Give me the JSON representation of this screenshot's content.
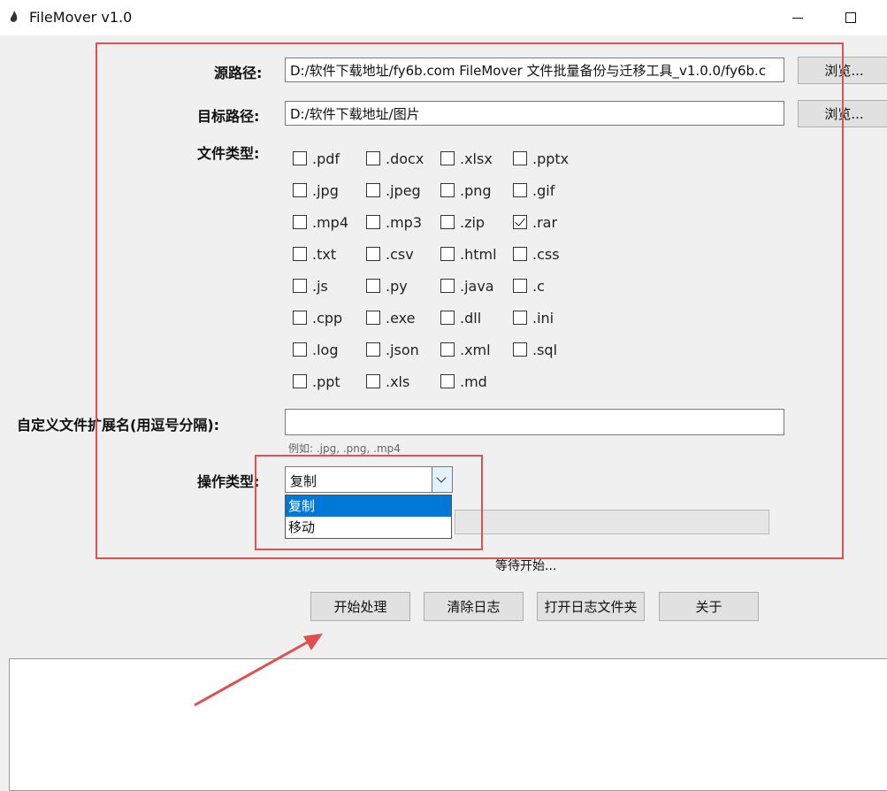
{
  "window": {
    "title": "FileMover v1.0"
  },
  "source": {
    "label": "源路径:",
    "value": "D:/软件下载地址/fy6b.com FileMover 文件批量备份与迁移工具_v1.0.0/fy6b.c",
    "browse": "浏览..."
  },
  "target": {
    "label": "目标路径:",
    "value": "D:/软件下载地址/图片",
    "browse": "浏览..."
  },
  "filetypes": {
    "label": "文件类型:",
    "items": [
      {
        "ext": ".pdf",
        "checked": false
      },
      {
        "ext": ".docx",
        "checked": false
      },
      {
        "ext": ".xlsx",
        "checked": false
      },
      {
        "ext": ".pptx",
        "checked": false
      },
      {
        "ext": ".jpg",
        "checked": false
      },
      {
        "ext": ".jpeg",
        "checked": false
      },
      {
        "ext": ".png",
        "checked": false
      },
      {
        "ext": ".gif",
        "checked": false
      },
      {
        "ext": ".mp4",
        "checked": false
      },
      {
        "ext": ".mp3",
        "checked": false
      },
      {
        "ext": ".zip",
        "checked": false
      },
      {
        "ext": ".rar",
        "checked": true
      },
      {
        "ext": ".txt",
        "checked": false
      },
      {
        "ext": ".csv",
        "checked": false
      },
      {
        "ext": ".html",
        "checked": false
      },
      {
        "ext": ".css",
        "checked": false
      },
      {
        "ext": ".js",
        "checked": false
      },
      {
        "ext": ".py",
        "checked": false
      },
      {
        "ext": ".java",
        "checked": false
      },
      {
        "ext": ".c",
        "checked": false
      },
      {
        "ext": ".cpp",
        "checked": false
      },
      {
        "ext": ".exe",
        "checked": false
      },
      {
        "ext": ".dll",
        "checked": false
      },
      {
        "ext": ".ini",
        "checked": false
      },
      {
        "ext": ".log",
        "checked": false
      },
      {
        "ext": ".json",
        "checked": false
      },
      {
        "ext": ".xml",
        "checked": false
      },
      {
        "ext": ".sql",
        "checked": false
      },
      {
        "ext": ".ppt",
        "checked": false
      },
      {
        "ext": ".xls",
        "checked": false
      },
      {
        "ext": ".md",
        "checked": false
      }
    ]
  },
  "custom_ext": {
    "label": "自定义文件扩展名(用逗号分隔):",
    "value": "",
    "hint": "例如: .jpg, .png, .mp4"
  },
  "operation": {
    "label": "操作类型:",
    "selected": "复制",
    "options": [
      "复制",
      "移动"
    ]
  },
  "status": "等待开始...",
  "buttons": {
    "start": "开始处理",
    "clear": "清除日志",
    "open_log": "打开日志文件夹",
    "about": "关于"
  },
  "annotation_color": "#e05050"
}
